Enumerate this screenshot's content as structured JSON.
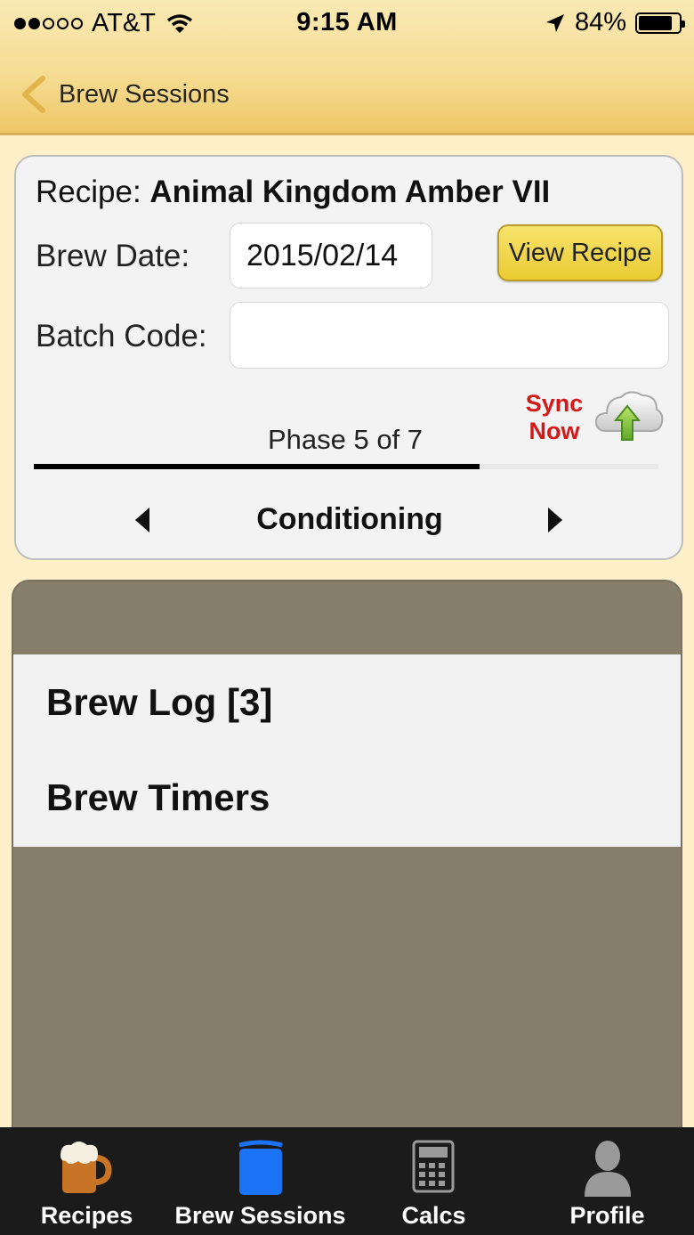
{
  "status": {
    "carrier": "AT&T",
    "time": "9:15 AM",
    "battery": "84%",
    "signal_bars_filled": 2,
    "signal_bars_total": 5
  },
  "nav": {
    "title": "Brew Sessions"
  },
  "session": {
    "recipe_label": "Recipe:",
    "recipe_name": "Animal Kingdom Amber VII",
    "brew_date_label": "Brew Date:",
    "brew_date_value": "2015/02/14",
    "view_recipe": "View Recipe",
    "batch_code_label": "Batch Code:",
    "batch_code_value": "",
    "sync_line1": "Sync",
    "sync_line2": "Now",
    "phase_text": "Phase 5 of 7",
    "phase_current": 5,
    "phase_total": 7,
    "phase_name": "Conditioning"
  },
  "menu": {
    "items": [
      {
        "label": "Brew Log [3]"
      },
      {
        "label": "Brew Timers"
      }
    ]
  },
  "tabs": [
    {
      "label": "Recipes",
      "icon": "beer-mug-icon",
      "selected": false
    },
    {
      "label": "Brew Sessions",
      "icon": "brew-kettle-icon",
      "selected": true
    },
    {
      "label": "Calcs",
      "icon": "calculator-icon",
      "selected": false
    },
    {
      "label": "Profile",
      "icon": "person-icon",
      "selected": false
    }
  ],
  "colors": {
    "accent_yellow": "#eacb33",
    "sync_red": "#d31a1a",
    "panel_brown": "#887e6c",
    "tab_selected_blue": "#1a73f5"
  }
}
